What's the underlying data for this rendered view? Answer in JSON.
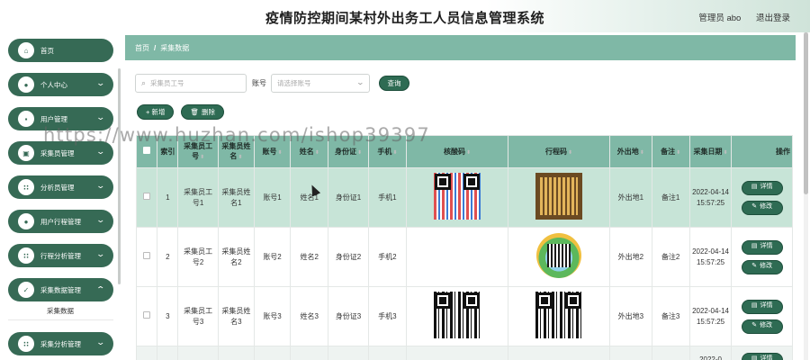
{
  "header": {
    "title": "疫情防控期间某村外出务工人员信息管理系统",
    "user_label": "管理员 abo",
    "logout_label": "退出登录"
  },
  "sidebar": {
    "items": [
      {
        "label": "首页",
        "icon": "home-icon",
        "has_arrow": false
      },
      {
        "label": "个人中心",
        "icon": "person-icon",
        "has_arrow": true
      },
      {
        "label": "用户管理",
        "icon": "users-icon",
        "has_arrow": true
      },
      {
        "label": "采集员管理",
        "icon": "collector-icon",
        "has_arrow": true
      },
      {
        "label": "分析员管理",
        "icon": "grid-icon",
        "has_arrow": true
      },
      {
        "label": "用户行程管理",
        "icon": "person-icon",
        "has_arrow": true
      },
      {
        "label": "行程分析管理",
        "icon": "grid-icon",
        "has_arrow": true
      },
      {
        "label": "采集数据管理",
        "icon": "clipboard-icon",
        "has_arrow": true
      },
      {
        "label": "采集分析管理",
        "icon": "grid-icon",
        "has_arrow": true
      }
    ],
    "submenu": {
      "label": "采集数据"
    }
  },
  "breadcrumb": {
    "home": "首页",
    "separator": "/",
    "current": "采集数据"
  },
  "search": {
    "collector_placeholder": "采集员工号",
    "account_label": "账号",
    "account_placeholder": "请选择账号",
    "query_button": "查询"
  },
  "actions": {
    "add": "+ 新增",
    "delete": "删除"
  },
  "table": {
    "columns": [
      "索引",
      "采集员工号",
      "采集员姓名",
      "账号",
      "姓名",
      "身份证",
      "手机",
      "核酸码",
      "行程码",
      "外出地",
      "备注",
      "采集日期",
      "操作"
    ],
    "rows": [
      {
        "index": "1",
        "collector_no": "采集员工号1",
        "collector_name": "采集员姓名1",
        "account": "账号1",
        "name": "姓名1",
        "id_card": "身份证1",
        "phone": "手机1",
        "origin": "外出地1",
        "note": "备注1",
        "date": "2022-04-14 15:57:25"
      },
      {
        "index": "2",
        "collector_no": "采集员工号2",
        "collector_name": "采集员姓名2",
        "account": "账号2",
        "name": "姓名2",
        "id_card": "身份证2",
        "phone": "手机2",
        "origin": "外出地2",
        "note": "备注2",
        "date": "2022-04-14 15:57:25"
      },
      {
        "index": "3",
        "collector_no": "采集员工号3",
        "collector_name": "采集员姓名3",
        "account": "账号3",
        "name": "姓名3",
        "id_card": "身份证3",
        "phone": "手机3",
        "origin": "外出地3",
        "note": "备注3",
        "date": "2022-04-14 15:57:25"
      },
      {
        "date": "2022-0"
      }
    ],
    "detail_button": "详情",
    "edit_button": "修改"
  },
  "watermark": "https://www.huzhan.com/ishop39397",
  "colors": {
    "primary": "#2e6b53",
    "menu": "#366a55",
    "header_row": "#7fb8a6",
    "selected_row": "#c7e4d7"
  }
}
